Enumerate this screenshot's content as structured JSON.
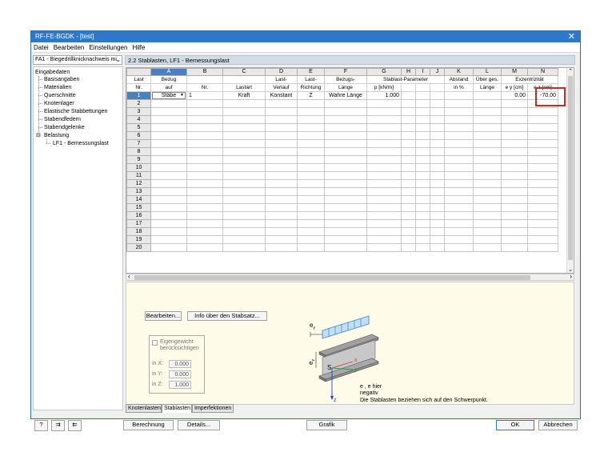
{
  "title": "RF-FE-BGDK - [test]",
  "menu": [
    "Datei",
    "Bearbeiten",
    "Einstellungen",
    "Hilfe"
  ],
  "case_combo": "FA1 - Biegedrillknicknachweis mi",
  "tree": {
    "root": "Eingabedaten",
    "items": [
      "Basisangaben",
      "Materialien",
      "Querschnitte",
      "Knotenlager",
      "Elastische Stabbettungen",
      "Stabendfedern",
      "Stabendgelenke"
    ],
    "belastung": "Belastung",
    "load_item": "LF1 - Bemessungslast"
  },
  "section_title": "2.2 Stablasten, LF1 - Bemessungslast",
  "table": {
    "col_letters": [
      "A",
      "B",
      "C",
      "D",
      "E",
      "F",
      "G",
      "H",
      "I",
      "J",
      "K",
      "L",
      "M",
      "N"
    ],
    "hdr_top": {
      "last": "Last",
      "bezug": "Bezug",
      "verlauf_top": "Last-",
      "richtung_top": "Last-",
      "bezugs": "Bezugs-",
      "stablast": "Stablast-Parameter",
      "abstand": "Abstand",
      "ueber": "Über ges.",
      "exz": "Exzentrizität"
    },
    "hdr_bot": {
      "nr": "Nr.",
      "auf": "auf",
      "stabnr": "Nr.",
      "lastart": "Lastart",
      "verlauf": "Verlauf",
      "richtung": "Richtung",
      "laenge": "Länge",
      "p": "p [kN/m]",
      "proz": "in %",
      "gl": "Länge",
      "ey": "e y [cm]",
      "ez": "e z [cm]"
    },
    "row1": {
      "nr": "1",
      "bezug": "Stäbe",
      "stab": "1",
      "lastart": "Kraft",
      "verlauf": "Konstant",
      "richtung": "Z",
      "laenge": "Wahre Länge",
      "p": "1.000",
      "ey": "0.00",
      "ez": "-70.00"
    },
    "rows": 20
  },
  "buttons": {
    "edit": "Bearbeiten...",
    "info": "Info über den Stabsatz...",
    "calc": "Berechnung",
    "details": "Details...",
    "graphic": "Grafik",
    "ok": "OK",
    "cancel": "Abbrechen"
  },
  "selfweight": {
    "label1": "Eigengewicht",
    "label2": "berücksichtigen",
    "inx": "in X:",
    "iny": "in Y:",
    "inz": "in Z:",
    "vx": "0.000",
    "vy": "0.000",
    "vz": "1.000"
  },
  "figure": {
    "ey": "e",
    "ez": "e",
    "ey_sub": "y",
    "ez_sub": "z",
    "s": "S",
    "x": "x",
    "y": "y",
    "z": "z",
    "note1": "e , e  hier",
    "note2": "negativ",
    "note3": "Die Stablasten beziehen sich auf den Schwerpunkt."
  },
  "tabs": [
    "Knotenlasten",
    "Stablasten",
    "Imperfektionen"
  ],
  "colors": {
    "title": "#2f78c8",
    "select": "#4a7fc1",
    "highlight": "#c62828"
  }
}
